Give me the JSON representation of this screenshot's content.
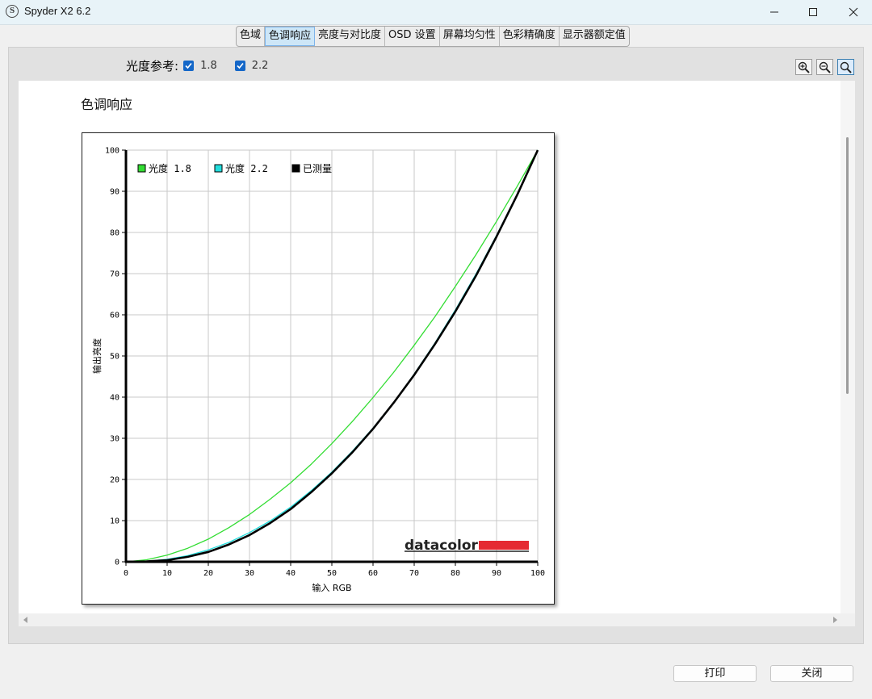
{
  "window": {
    "title": "Spyder X2 6.2",
    "app_icon_letter": "S"
  },
  "tabs": [
    {
      "label": "色域",
      "active": false
    },
    {
      "label": "色调响应",
      "active": true
    },
    {
      "label": "亮度与对比度",
      "active": false
    },
    {
      "label": "OSD 设置",
      "active": false
    },
    {
      "label": "屏幕均匀性",
      "active": false
    },
    {
      "label": "色彩精确度",
      "active": false
    },
    {
      "label": "显示器额定值",
      "active": false
    }
  ],
  "gamma_reference": {
    "label": "光度参考:",
    "options": [
      {
        "label": "1.8",
        "checked": true
      },
      {
        "label": "2.2",
        "checked": true
      }
    ]
  },
  "zoom": {
    "zoom_in": "zoom-in-icon",
    "zoom_out": "zoom-out-icon",
    "zoom_reset": "zoom-fit-icon"
  },
  "section": {
    "title": "色调响应"
  },
  "chart_data": {
    "type": "line",
    "title": "",
    "xlabel": "输入 RGB",
    "ylabel": "输出亮度",
    "xlim": [
      0,
      100
    ],
    "ylim": [
      0,
      100
    ],
    "xticks": [
      0,
      10,
      20,
      30,
      40,
      50,
      60,
      70,
      80,
      90,
      100
    ],
    "yticks": [
      0,
      10,
      20,
      30,
      40,
      50,
      60,
      70,
      80,
      90,
      100
    ],
    "grid": true,
    "legend_position": "top-left",
    "brand": "datacolor",
    "series": [
      {
        "name": "光度 1.8",
        "color": "#33dd33",
        "x": [
          0,
          5,
          10,
          15,
          20,
          25,
          30,
          35,
          40,
          45,
          50,
          55,
          60,
          65,
          70,
          75,
          80,
          85,
          90,
          95,
          100
        ],
        "y": [
          0,
          0.5,
          1.6,
          3.3,
          5.5,
          8.3,
          11.5,
          15.2,
          19.2,
          23.7,
          28.7,
          34.1,
          39.9,
          46.0,
          52.6,
          59.5,
          66.9,
          74.6,
          82.7,
          91.2,
          100
        ]
      },
      {
        "name": "光度 2.2",
        "color": "#22dddd",
        "x": [
          0,
          5,
          10,
          15,
          20,
          25,
          30,
          35,
          40,
          45,
          50,
          55,
          60,
          65,
          70,
          75,
          80,
          85,
          90,
          95,
          100
        ],
        "y": [
          0,
          0.1,
          0.6,
          1.5,
          2.9,
          4.7,
          7.1,
          9.9,
          13.3,
          17.3,
          21.8,
          26.9,
          32.5,
          38.7,
          45.6,
          53.1,
          61.2,
          69.9,
          79.3,
          89.3,
          100
        ]
      },
      {
        "name": "已测量",
        "color": "#000000",
        "x": [
          0,
          5,
          10,
          15,
          20,
          25,
          30,
          35,
          40,
          45,
          50,
          55,
          60,
          65,
          70,
          75,
          80,
          85,
          90,
          95,
          100
        ],
        "y": [
          0,
          0.1,
          0.4,
          1.2,
          2.4,
          4.2,
          6.5,
          9.4,
          12.8,
          16.9,
          21.5,
          26.6,
          32.3,
          38.6,
          45.4,
          52.8,
          60.8,
          69.5,
          79.0,
          89.1,
          100
        ]
      }
    ]
  },
  "buttons": {
    "print": "打印",
    "close": "关闭"
  }
}
